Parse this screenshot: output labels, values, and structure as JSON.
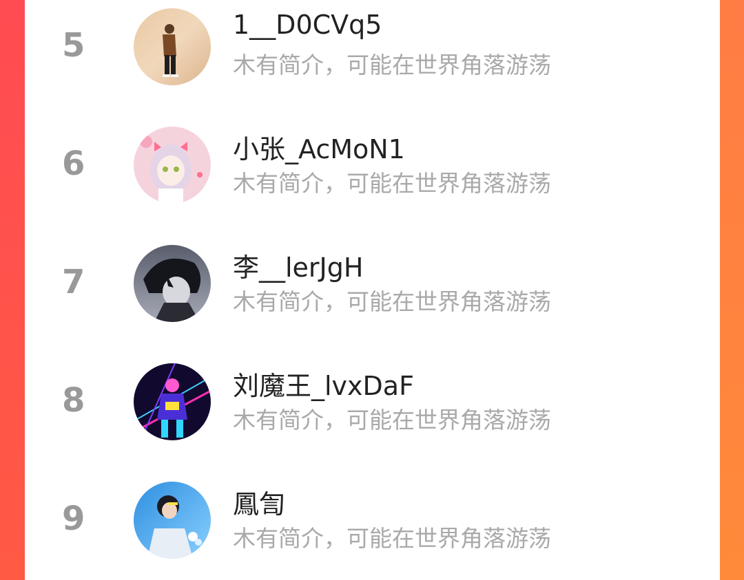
{
  "ranking_list": {
    "items": [
      {
        "rank": "5",
        "name": "1__D0CVq5",
        "bio": "木有简介，可能在世界角落游荡",
        "avatar_icon": "user-avatar-walking-figure-icon"
      },
      {
        "rank": "6",
        "name": "小张_AcMoN1",
        "bio": "木有简介，可能在世界角落游荡",
        "avatar_icon": "user-avatar-anime-girl-icon"
      },
      {
        "rank": "7",
        "name": "李__lerJgH",
        "bio": "木有简介，可能在世界角落游荡",
        "avatar_icon": "user-avatar-dark-anime-boy-icon"
      },
      {
        "rank": "8",
        "name": "刘魔王_lvxDaF",
        "bio": "木有简介，可能在世界角落游荡",
        "avatar_icon": "user-avatar-neon-figure-icon"
      },
      {
        "rank": "9",
        "name": "鳳訇",
        "bio": "木有简介，可能在世界角落游荡",
        "avatar_icon": "user-avatar-blue-portrait-icon"
      }
    ]
  },
  "colors": {
    "left_band": "#ff4b52",
    "right_band": "#ff8a3a",
    "rank_text": "#999999",
    "name_text": "#222222",
    "bio_text": "#a9a9a9"
  }
}
